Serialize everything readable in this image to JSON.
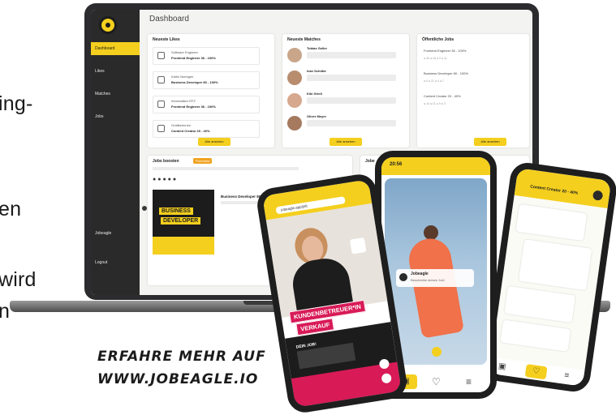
{
  "left_text": [
    "ing-",
    "en",
    "wird",
    "n"
  ],
  "dashboard": {
    "title": "Dashboard",
    "nav": [
      "Dashboard",
      "Likes",
      "Matches",
      "Jobs",
      "Jobeagle",
      "Logout"
    ],
    "likes": {
      "title": "Neueste Likes",
      "items": [
        {
          "line1": "Software Engineer",
          "line2": "Frontend Engineer 36 - 100%"
        },
        {
          "line1": "Kalim Noringen",
          "line2": "Business Developer 80 - 100%"
        },
        {
          "line1": "Informatiker EFZ",
          "line2": "Frontend Engineer 36 - 100%"
        },
        {
          "line1": "Grafikerinnen",
          "line2": "Content Creator 20 - 40%"
        }
      ],
      "button": "Alle ansehen"
    },
    "matches": {
      "title": "Neueste Matches",
      "items": [
        {
          "name": "Tobias Geller",
          "msg": ""
        },
        {
          "name": "Ivan Schütte",
          "msg": ""
        },
        {
          "name": "Kiki Grieß",
          "msg": ""
        },
        {
          "name": "Oliver Meyer",
          "msg": ""
        }
      ],
      "button": "Alle ansehen"
    },
    "public_jobs": {
      "title": "Öffentliche Jobs",
      "items": [
        "Frontend Engineer 36 - 100%",
        "Business Developer 80 - 100%",
        "Content Creator 20 - 40%"
      ],
      "stats": [
        "● 42  ● 16  ● 9  ● 11",
        "● 9  ● 21  ● 4  ● 7",
        "● 14  ● 11  ● 9  ● 3"
      ],
      "button": "Alle ansehen"
    },
    "boost": {
      "title": "Jobs boosten",
      "badge": "Promoted",
      "job": "Business Developer 80",
      "poster_line1": "BUSINESS",
      "poster_line2": "DEVELOPER",
      "second_title": "Jobe"
    }
  },
  "phone1": {
    "url": "jobeagle.app/job",
    "banner1": "KUNDENBETREUER*IN",
    "banner2": "VERKAUF",
    "bottom_text": "DEIN JOB!"
  },
  "phone2": {
    "time": "20:56",
    "card_name": "Jobeagle",
    "card_sub": "Beschreibe deinen Job!"
  },
  "phone3": {
    "header": "Content Creator 20 - 40%"
  },
  "tagline": [
    "ERFAHRE MEHR AUF",
    "WWW.JOBEAGLE.IO"
  ],
  "colors": {
    "accent": "#f4cf1e",
    "dark": "#2a2a2a",
    "pink": "#d81a57"
  }
}
